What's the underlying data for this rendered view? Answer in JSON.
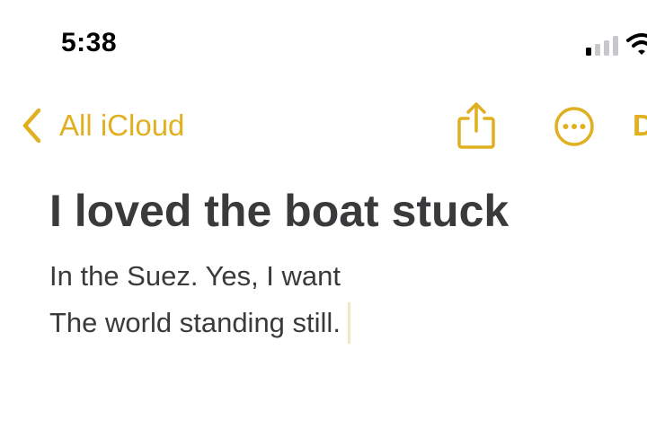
{
  "status_bar": {
    "time": "5:38"
  },
  "nav": {
    "back_label": "All iCloud",
    "done_label": "D",
    "accent_color": "#e1b020"
  },
  "note": {
    "title": "I loved the boat stuck",
    "lines": [
      "In the Suez. Yes, I want",
      "The world standing still."
    ],
    "text_color": "#3a3a3c"
  },
  "icons": {
    "back": "chevron-left-icon",
    "share": "share-icon",
    "more": "ellipsis-circle-icon",
    "signal": "cellular-signal-icon",
    "wifi": "wifi-icon"
  }
}
